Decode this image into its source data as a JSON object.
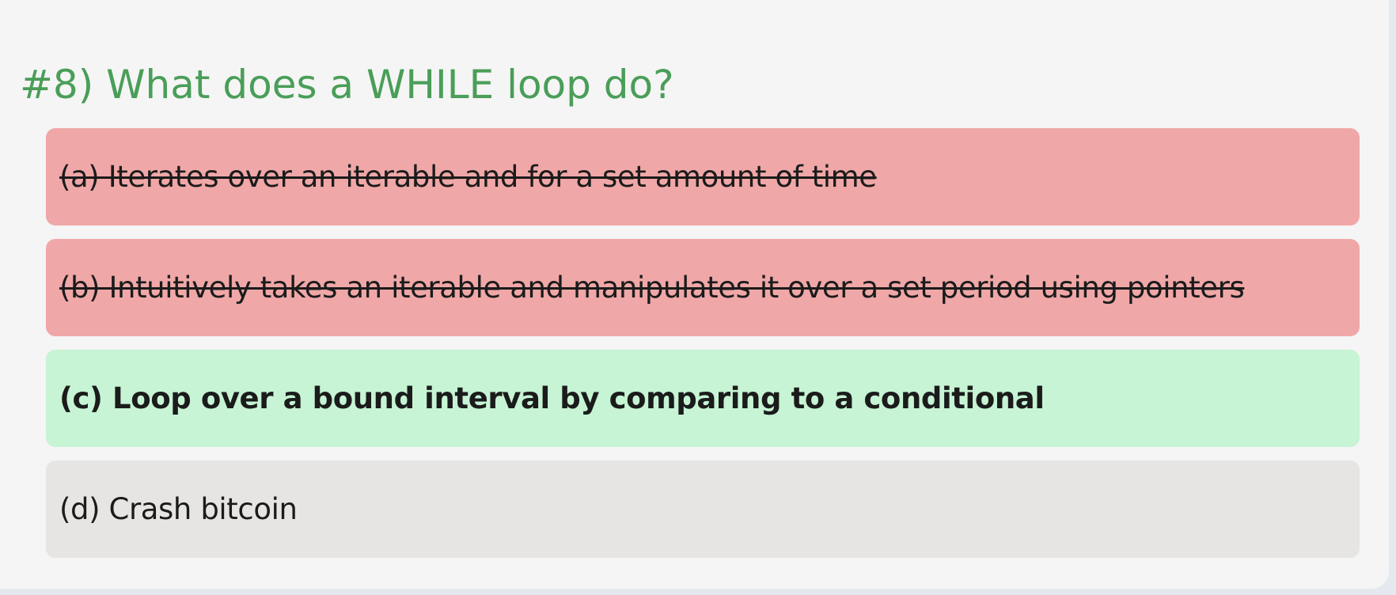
{
  "question": {
    "title": "#8) What does a WHILE loop do?"
  },
  "options": [
    {
      "text": "(a) Iterates over an iterable and for a set amount of time",
      "state": "wrong"
    },
    {
      "text": "(b) Intuitively takes an iterable and manipulates it over a set period using pointers",
      "state": "wrong"
    },
    {
      "text": "(c) Loop over a bound interval by comparing to a conditional",
      "state": "correct"
    },
    {
      "text": "(d) Crash bitcoin",
      "state": "neutral"
    }
  ],
  "colors": {
    "title": "#4a9e58",
    "wrong_bg": "#f0a7a7",
    "correct_bg": "#c6f4d4",
    "neutral_bg": "#e6e5e3",
    "card_bg": "#f5f5f5"
  }
}
